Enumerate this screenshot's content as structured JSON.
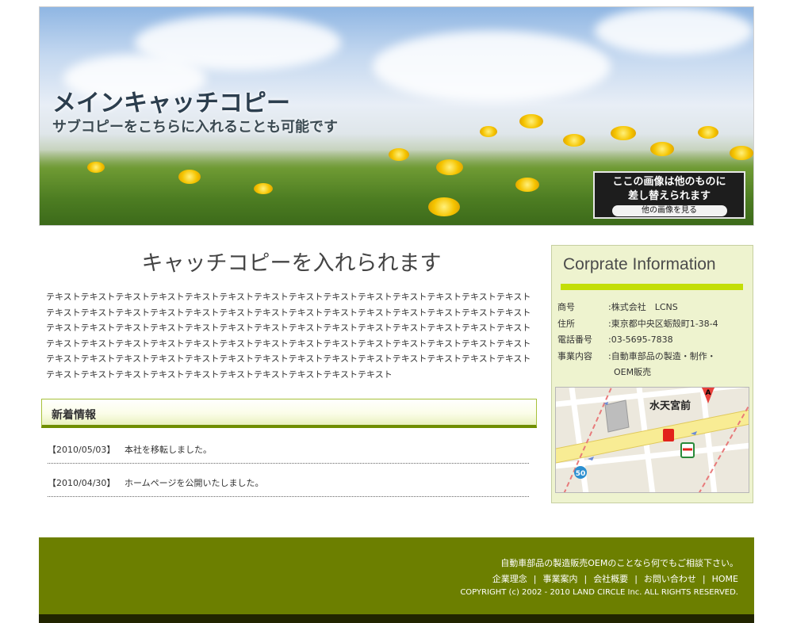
{
  "hero": {
    "title": "メインキャッチコピー",
    "subtitle": "サブコピーをこちらに入れることも可能です",
    "note_line1": "ここの画像は他のものに",
    "note_line2": "差し替えられます",
    "note_button": "他の画像を見る"
  },
  "main": {
    "catch_copy": "キャッチコピーを入れられます",
    "body_text": "テキストテキストテキストテキストテキストテキストテキストテキストテキストテキストテキストテキストテキストテキストテキストテキストテキストテキストテキストテキストテキストテキストテキストテキストテキストテキストテキストテキストテキストテキストテキストテキストテキストテキストテキストテキストテキストテキストテキストテキストテキストテキストテキストテキストテキストテキストテキストテキストテキストテキストテキストテキストテキストテキストテキストテキストテキストテキストテキストテキストテキストテキストテキストテキストテキストテキストテキストテキストテキストテキストテキストテキストテキストテキストテキストテキストテキストテキストテキストテキスト"
  },
  "news": {
    "heading": "新着情報",
    "items": [
      {
        "date": "【2010/05/03】",
        "text": "本社を移転しました。"
      },
      {
        "date": "【2010/04/30】",
        "text": "ホームページを公開いたしました。"
      }
    ]
  },
  "sidebar": {
    "title": "Corprate Information",
    "info": [
      {
        "label": "商号",
        "value": ":株式会社　LCNS"
      },
      {
        "label": "住所",
        "value": ":東京都中央区蛎殻町1-38-4"
      },
      {
        "label": "電話番号",
        "value": ":03-5695-7838"
      },
      {
        "label": "事業内容",
        "value": ":自動車部品の製造・制作・"
      },
      {
        "label": "",
        "value": "  OEM販売"
      }
    ],
    "map": {
      "station_label": "水天宮前",
      "route_number": "50",
      "marker_letter": "A"
    }
  },
  "footer": {
    "message": "自動車部品の製造販売OEMのことなら何でもご相談下さい。",
    "nav": [
      "企業理念",
      "事業案内",
      "会社概要",
      "お問い合わせ",
      "HOME"
    ],
    "copyright": "COPYRIGHT (c) 2002 - 2010 LAND CIRCLE Inc. ALL RIGHTS RESERVED."
  },
  "colors": {
    "accent_green": "#6c7f00",
    "lime_bar": "#c3de07",
    "sidebar_bg": "#eef3cf"
  }
}
